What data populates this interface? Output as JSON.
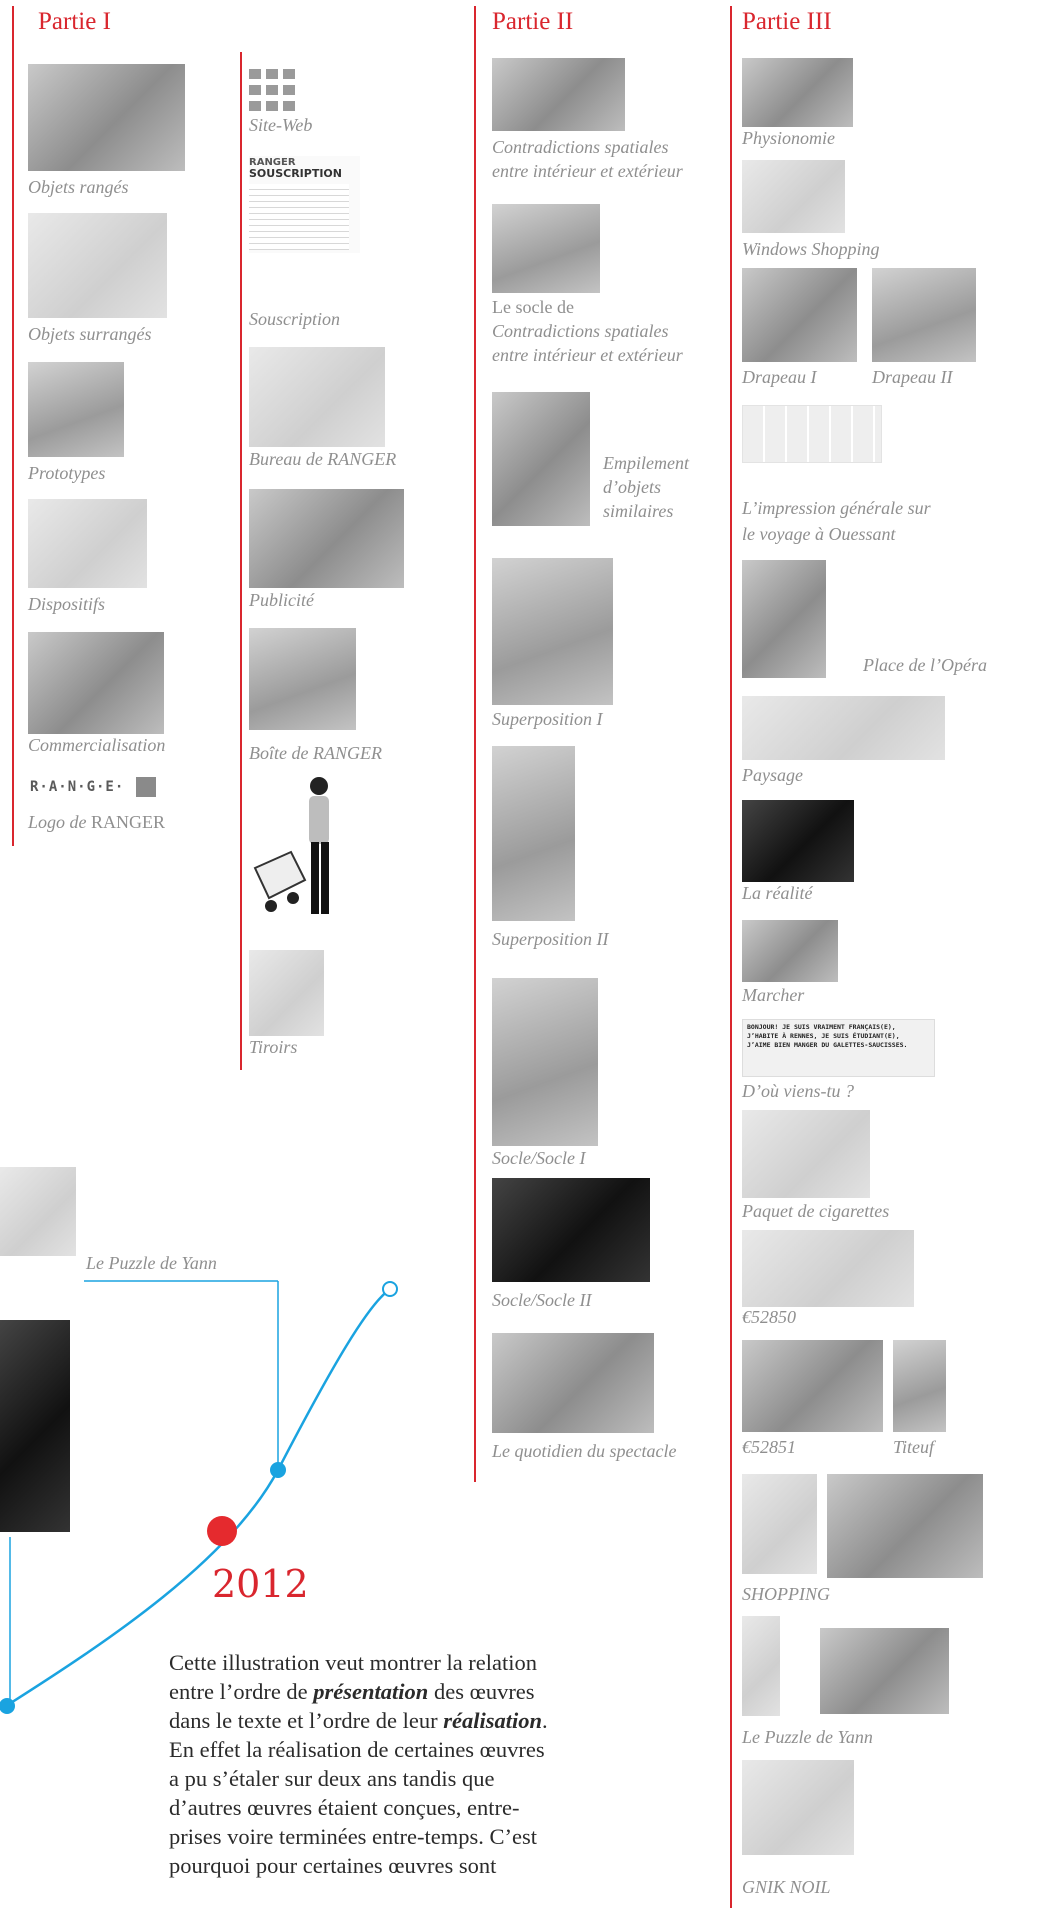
{
  "parts": {
    "p1": "Partie I",
    "p2": "Partie II",
    "p3": "Partie III"
  },
  "col1": {
    "items": [
      "Objets rangés",
      "Objets surrangés",
      "Prototypes",
      "Dispositifs",
      "Commercialisation"
    ],
    "logo_text": "R·A·N·G·E·",
    "logo_caption_a": "Logo de",
    "logo_caption_b": "RANGER"
  },
  "col2": {
    "items": [
      "Site-Web",
      "Souscription",
      "Bureau de RANGER",
      "Publicité",
      "Boîte de RANGER",
      "Tiroirs"
    ],
    "souscription_l1": "RANGER",
    "souscription_l2": "SOUSCRIPTION"
  },
  "col3": {
    "item1_l1": "Contradictions spatiales",
    "item1_l2": "entre intérieur et extérieur",
    "item2_l1": "Le socle de",
    "item2_l2": "Contradictions spatiales",
    "item2_l3": "entre intérieur et extérieur",
    "item3_l1": "Empilement",
    "item3_l2": "d’objets",
    "item3_l3": "similaires",
    "items": [
      "Superposition I",
      "Superposition II",
      "Socle/Socle I",
      "Socle/Socle II",
      "Le quotidien du spectacle"
    ]
  },
  "col4": {
    "physionomie": "Physionomie",
    "windows": "Windows Shopping",
    "drapeau1": "Drapeau I",
    "drapeau2": "Drapeau II",
    "impression_l1": "L’impression générale sur",
    "impression_l2": "le voyage à Ouessant",
    "opera": "Place de l’Opéra",
    "paysage": "Paysage",
    "realite": "La réalité",
    "marcher": "Marcher",
    "bonjour_l1": "BONJOUR! JE SUIS VRAIMENT FRANÇAIS(E),",
    "bonjour_l2": "J’HABITE À RENNES, JE SUIS ÉTUDIANT(E),",
    "bonjour_l3": "J’AIME BIEN MANGER DU GALETTES-SAUCISSES.",
    "dou": "D’où viens-tu ?",
    "paquet": "Paquet de cigarettes",
    "e52850": "€52850",
    "e52851": "€52851",
    "titeuf": "Titeuf",
    "shopping": "SHOPPING",
    "puzzle": "Le Puzzle de Yann",
    "gnik": "GNIK NOIL"
  },
  "timeline": {
    "puzzle_label": "Le Puzzle de Yann",
    "year": "2012",
    "colors": {
      "accent": "#d9262e",
      "line": "#1aa3e0"
    }
  },
  "paragraph": {
    "l1": "Cette illustration veut montrer la relation",
    "l2a": "entre l’ordre de ",
    "l2b": "présentation",
    "l2c": " des œuvres",
    "l3a": "dans le texte et l’ordre de leur ",
    "l3b": "réalisation",
    "l3c": ".",
    "l4": "En effet la réalisation de certaines œuvres",
    "l5": "a pu s’étaler sur deux ans tandis que",
    "l6": "d’autres œuvres étaient conçues, entre-",
    "l7": "prises voire terminées entre-temps. C’est",
    "l8": "pourquoi pour certaines œuvres sont"
  }
}
